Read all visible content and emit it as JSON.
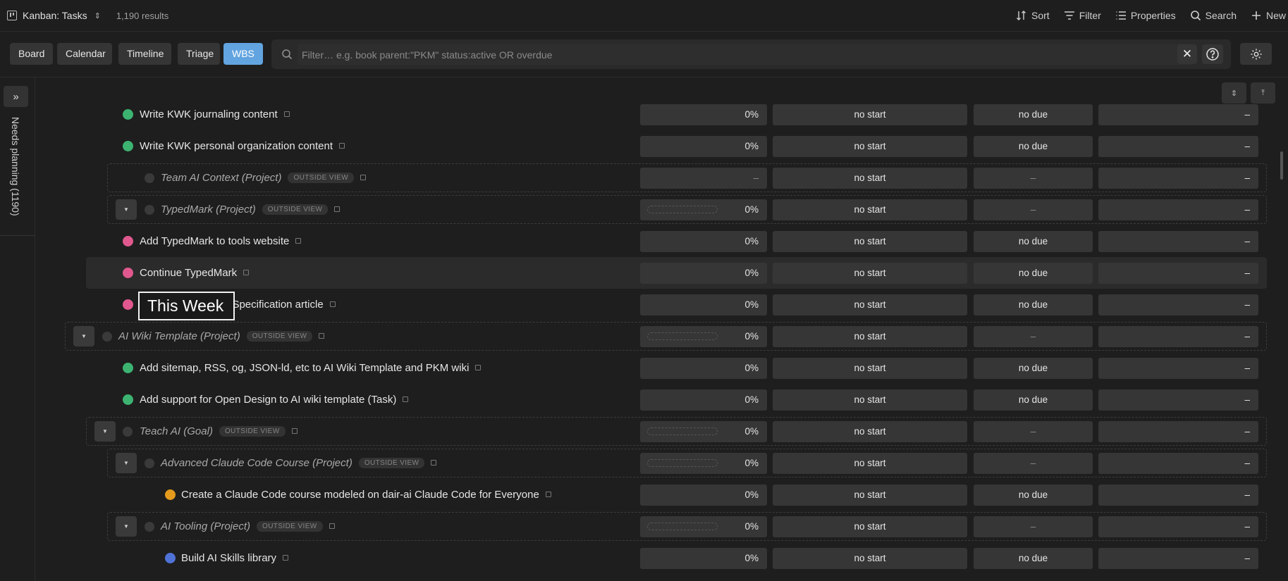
{
  "header": {
    "title": "Kanban: Tasks",
    "results": "1,190 results",
    "actions": [
      {
        "id": "sort",
        "label": "Sort",
        "icon": "sort-icon"
      },
      {
        "id": "filter",
        "label": "Filter",
        "icon": "filter-icon"
      },
      {
        "id": "properties",
        "label": "Properties",
        "icon": "list-icon"
      },
      {
        "id": "search",
        "label": "Search",
        "icon": "search-icon"
      },
      {
        "id": "new",
        "label": "New",
        "icon": "plus-icon"
      }
    ]
  },
  "views": {
    "tabs": [
      "Board",
      "Calendar",
      "Timeline",
      "Triage",
      "WBS"
    ],
    "active": "WBS"
  },
  "filter": {
    "value": "",
    "placeholder": "Filter… e.g. book parent:\"PKM\" status:active OR overdue"
  },
  "sidebar": {
    "expand_label": "»",
    "panel_label": "Needs planning (1190)"
  },
  "tooltip": "This Week",
  "colors": {
    "accent": "#62a4e0",
    "green": "#3cb371",
    "pink": "#e0588e",
    "orange": "#e39a1d",
    "blue": "#4f72d6"
  },
  "rows": [
    {
      "title": "Write KWK journaling content",
      "ghost": false,
      "indent": 1,
      "dot": "#3cb371",
      "progress": "0%",
      "start": "no start",
      "due": "no due",
      "last": "–",
      "has_toggle": false,
      "show_bar": false
    },
    {
      "title": "Write KWK personal organization content",
      "ghost": false,
      "indent": 1,
      "dot": "#3cb371",
      "progress": "0%",
      "start": "no start",
      "due": "no due",
      "last": "–",
      "has_toggle": false,
      "show_bar": false
    },
    {
      "title": "Team AI Context (Project)",
      "ghost": true,
      "badge": "OUTSIDE VIEW",
      "indent": 2,
      "progress": "–",
      "start": "no start",
      "due": "–",
      "last": "–",
      "has_toggle": false,
      "show_bar": false
    },
    {
      "title": "TypedMark (Project)",
      "ghost": true,
      "badge": "OUTSIDE VIEW",
      "indent": 2,
      "progress": "0%",
      "start": "no start",
      "due": "–",
      "last": "–",
      "has_toggle": true,
      "show_bar": true
    },
    {
      "title": "Add TypedMark to tools website",
      "ghost": false,
      "indent": 1,
      "dot": "#e0588e",
      "progress": "0%",
      "start": "no start",
      "due": "no due",
      "last": "–",
      "has_toggle": false,
      "show_bar": false
    },
    {
      "title": "Continue TypedMark",
      "ghost": false,
      "indent": 1,
      "dot": "#e0588e",
      "progress": "0%",
      "start": "no start",
      "due": "no due",
      "last": "–",
      "has_toggle": false,
      "show_bar": false,
      "highlight": true
    },
    {
      "title": "Publish TypedMark Specification article",
      "ghost": false,
      "indent": 1,
      "dot": "#e0588e",
      "progress": "0%",
      "start": "no start",
      "due": "no due",
      "last": "–",
      "has_toggle": false,
      "show_bar": false
    },
    {
      "title": "AI Wiki Template (Project)",
      "ghost": true,
      "badge": "OUTSIDE VIEW",
      "indent": 0,
      "progress": "0%",
      "start": "no start",
      "due": "–",
      "last": "–",
      "has_toggle": true,
      "show_bar": true
    },
    {
      "title": "Add sitemap, RSS, og, JSON-ld, etc to AI Wiki Template and PKM wiki",
      "ghost": false,
      "indent": 1,
      "dot": "#3cb371",
      "progress": "0%",
      "start": "no start",
      "due": "no due",
      "last": "–",
      "has_toggle": false,
      "show_bar": false
    },
    {
      "title": "Add support for Open Design to AI wiki template (Task)",
      "ghost": false,
      "indent": 1,
      "dot": "#3cb371",
      "progress": "0%",
      "start": "no start",
      "due": "no due",
      "last": "–",
      "has_toggle": false,
      "show_bar": false
    },
    {
      "title": "Teach AI (Goal)",
      "ghost": true,
      "badge": "OUTSIDE VIEW",
      "indent": 1,
      "progress": "0%",
      "start": "no start",
      "due": "–",
      "last": "–",
      "has_toggle": true,
      "show_bar": true
    },
    {
      "title": "Advanced Claude Code Course (Project)",
      "ghost": true,
      "badge": "OUTSIDE VIEW",
      "indent": 2,
      "progress": "0%",
      "start": "no start",
      "due": "–",
      "last": "–",
      "has_toggle": true,
      "show_bar": true
    },
    {
      "title": "Create a Claude Code course modeled on dair-ai Claude Code for Everyone",
      "ghost": false,
      "indent": 3,
      "dot": "#e39a1d",
      "progress": "0%",
      "start": "no start",
      "due": "no due",
      "last": "–",
      "has_toggle": false,
      "show_bar": false
    },
    {
      "title": "AI Tooling (Project)",
      "ghost": true,
      "badge": "OUTSIDE VIEW",
      "indent": 2,
      "progress": "0%",
      "start": "no start",
      "due": "–",
      "last": "–",
      "has_toggle": true,
      "show_bar": true
    },
    {
      "title": "Build AI Skills library",
      "ghost": false,
      "indent": 3,
      "dot": "#4f72d6",
      "progress": "0%",
      "start": "no start",
      "due": "no due",
      "last": "–",
      "has_toggle": false,
      "show_bar": false
    }
  ]
}
